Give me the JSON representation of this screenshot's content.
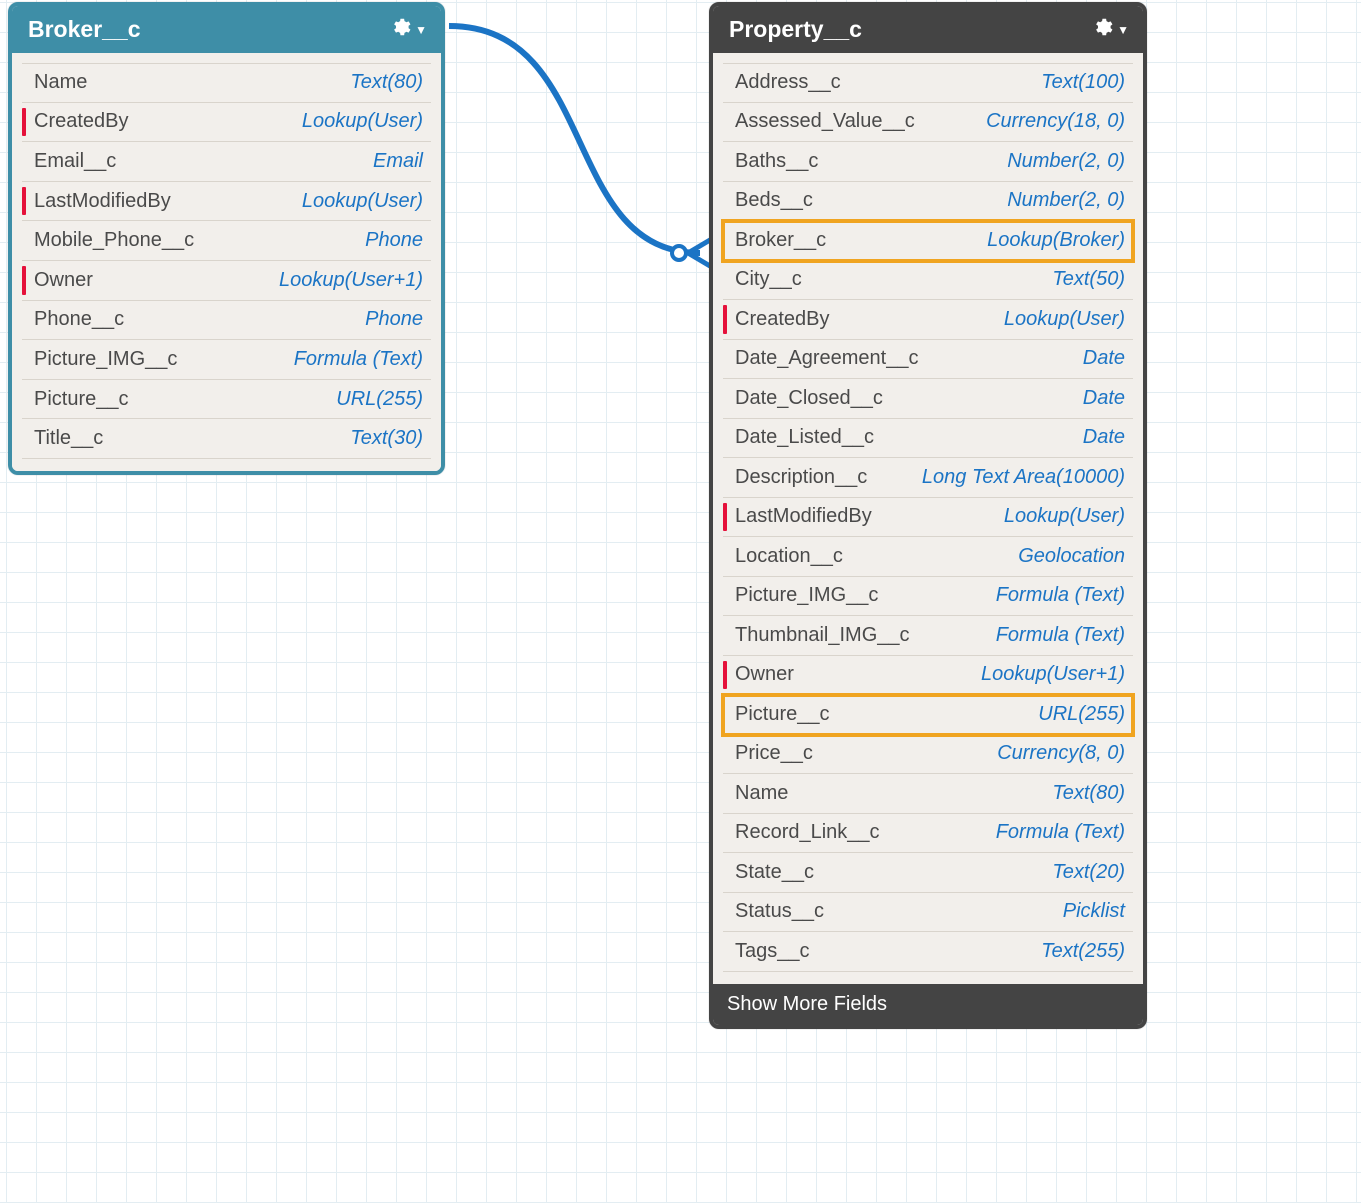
{
  "entities": [
    {
      "id": "broker",
      "title": "Broker__c",
      "fields": [
        {
          "name": "Name",
          "type": "Text(80)",
          "required": false,
          "highlight": false
        },
        {
          "name": "CreatedBy",
          "type": "Lookup(User)",
          "required": true,
          "highlight": false
        },
        {
          "name": "Email__c",
          "type": "Email",
          "required": false,
          "highlight": false
        },
        {
          "name": "LastModifiedBy",
          "type": "Lookup(User)",
          "required": true,
          "highlight": false
        },
        {
          "name": "Mobile_Phone__c",
          "type": "Phone",
          "required": false,
          "highlight": false
        },
        {
          "name": "Owner",
          "type": "Lookup(User+1)",
          "required": true,
          "highlight": false
        },
        {
          "name": "Phone__c",
          "type": "Phone",
          "required": false,
          "highlight": false
        },
        {
          "name": "Picture_IMG__c",
          "type": "Formula (Text)",
          "required": false,
          "highlight": false
        },
        {
          "name": "Picture__c",
          "type": "URL(255)",
          "required": false,
          "highlight": false
        },
        {
          "name": "Title__c",
          "type": "Text(30)",
          "required": false,
          "highlight": false
        }
      ],
      "showMore": null
    },
    {
      "id": "property",
      "title": "Property__c",
      "fields": [
        {
          "name": "Address__c",
          "type": "Text(100)",
          "required": false,
          "highlight": false
        },
        {
          "name": "Assessed_Value__c",
          "type": "Currency(18, 0)",
          "required": false,
          "highlight": false
        },
        {
          "name": "Baths__c",
          "type": "Number(2, 0)",
          "required": false,
          "highlight": false
        },
        {
          "name": "Beds__c",
          "type": "Number(2, 0)",
          "required": false,
          "highlight": false
        },
        {
          "name": "Broker__c",
          "type": "Lookup(Broker)",
          "required": false,
          "highlight": true
        },
        {
          "name": "City__c",
          "type": "Text(50)",
          "required": false,
          "highlight": false
        },
        {
          "name": "CreatedBy",
          "type": "Lookup(User)",
          "required": true,
          "highlight": false
        },
        {
          "name": "Date_Agreement__c",
          "type": "Date",
          "required": false,
          "highlight": false
        },
        {
          "name": "Date_Closed__c",
          "type": "Date",
          "required": false,
          "highlight": false
        },
        {
          "name": "Date_Listed__c",
          "type": "Date",
          "required": false,
          "highlight": false
        },
        {
          "name": "Description__c",
          "type": "Long Text Area(10000)",
          "required": false,
          "highlight": false
        },
        {
          "name": "LastModifiedBy",
          "type": "Lookup(User)",
          "required": true,
          "highlight": false
        },
        {
          "name": "Location__c",
          "type": "Geolocation",
          "required": false,
          "highlight": false
        },
        {
          "name": "Picture_IMG__c",
          "type": "Formula (Text)",
          "required": false,
          "highlight": false
        },
        {
          "name": "Thumbnail_IMG__c",
          "type": "Formula (Text)",
          "required": false,
          "highlight": false
        },
        {
          "name": "Owner",
          "type": "Lookup(User+1)",
          "required": true,
          "highlight": false
        },
        {
          "name": "Picture__c",
          "type": "URL(255)",
          "required": false,
          "highlight": true
        },
        {
          "name": "Price__c",
          "type": "Currency(8, 0)",
          "required": false,
          "highlight": false
        },
        {
          "name": "Name",
          "type": "Text(80)",
          "required": false,
          "highlight": false
        },
        {
          "name": "Record_Link__c",
          "type": "Formula (Text)",
          "required": false,
          "highlight": false
        },
        {
          "name": "State__c",
          "type": "Text(20)",
          "required": false,
          "highlight": false
        },
        {
          "name": "Status__c",
          "type": "Picklist",
          "required": false,
          "highlight": false
        },
        {
          "name": "Tags__c",
          "type": "Text(255)",
          "required": false,
          "highlight": false
        }
      ],
      "showMore": "Show More Fields"
    }
  ]
}
